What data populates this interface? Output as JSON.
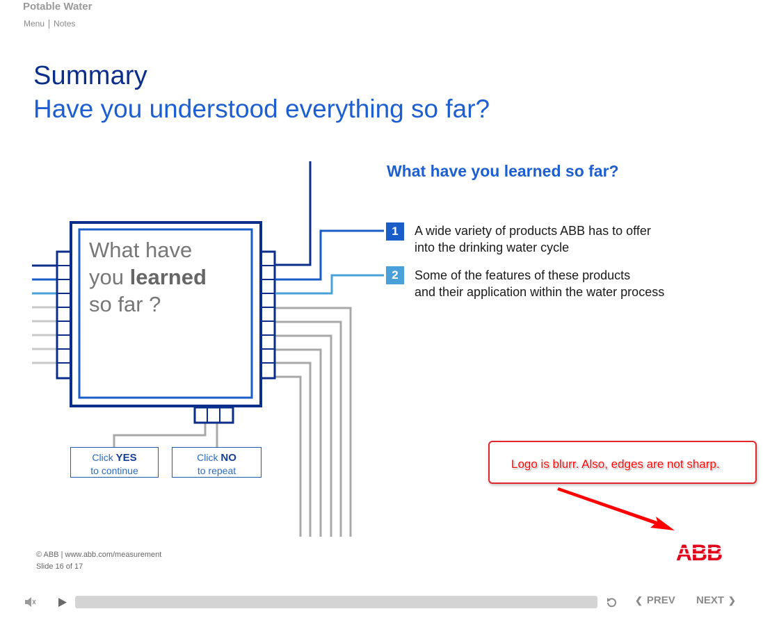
{
  "header": {
    "app_title": "Potable Water",
    "menu_label": "Menu",
    "notes_label": "Notes"
  },
  "slide": {
    "title": "Summary",
    "subtitle": "Have you understood everything so far?",
    "learned_heading": "What have you learned so far?",
    "items": [
      {
        "number": "1",
        "line1": "A wide variety of products ABB has to offer",
        "line2": "into the drinking water cycle",
        "color": "#1a5cc8"
      },
      {
        "number": "2",
        "line1": "Some of the features of  these products",
        "line2": "and their application within the water process",
        "color": "#4aa0d8"
      }
    ],
    "chip": {
      "line1": "What have",
      "line2_pre": "you ",
      "line2_bold": "learned",
      "line3": "so far ?"
    },
    "yes_button": {
      "click": "Click ",
      "word": "YES",
      "sub": "to continue"
    },
    "no_button": {
      "click": "Click ",
      "word": "NO",
      "sub": "to repeat"
    }
  },
  "annotation": {
    "text": "Logo is blurr. Also, edges are not sharp."
  },
  "footer": {
    "copyright": "© ABB | www.abb.com/measurement",
    "slide_counter": "Slide 16 of 17",
    "logo_text": "ABB"
  },
  "player": {
    "volume_icon": "speaker-icon",
    "play_icon": "play-icon",
    "replay_icon": "replay-icon",
    "prev_label": "PREV",
    "next_label": "NEXT",
    "progress": 0
  },
  "colors": {
    "dark_blue": "#0a2e8a",
    "blue": "#1d5fd1",
    "light_blue": "#4aa0d8",
    "annotation_red": "#e0262b",
    "abb_red": "#e2001a"
  }
}
